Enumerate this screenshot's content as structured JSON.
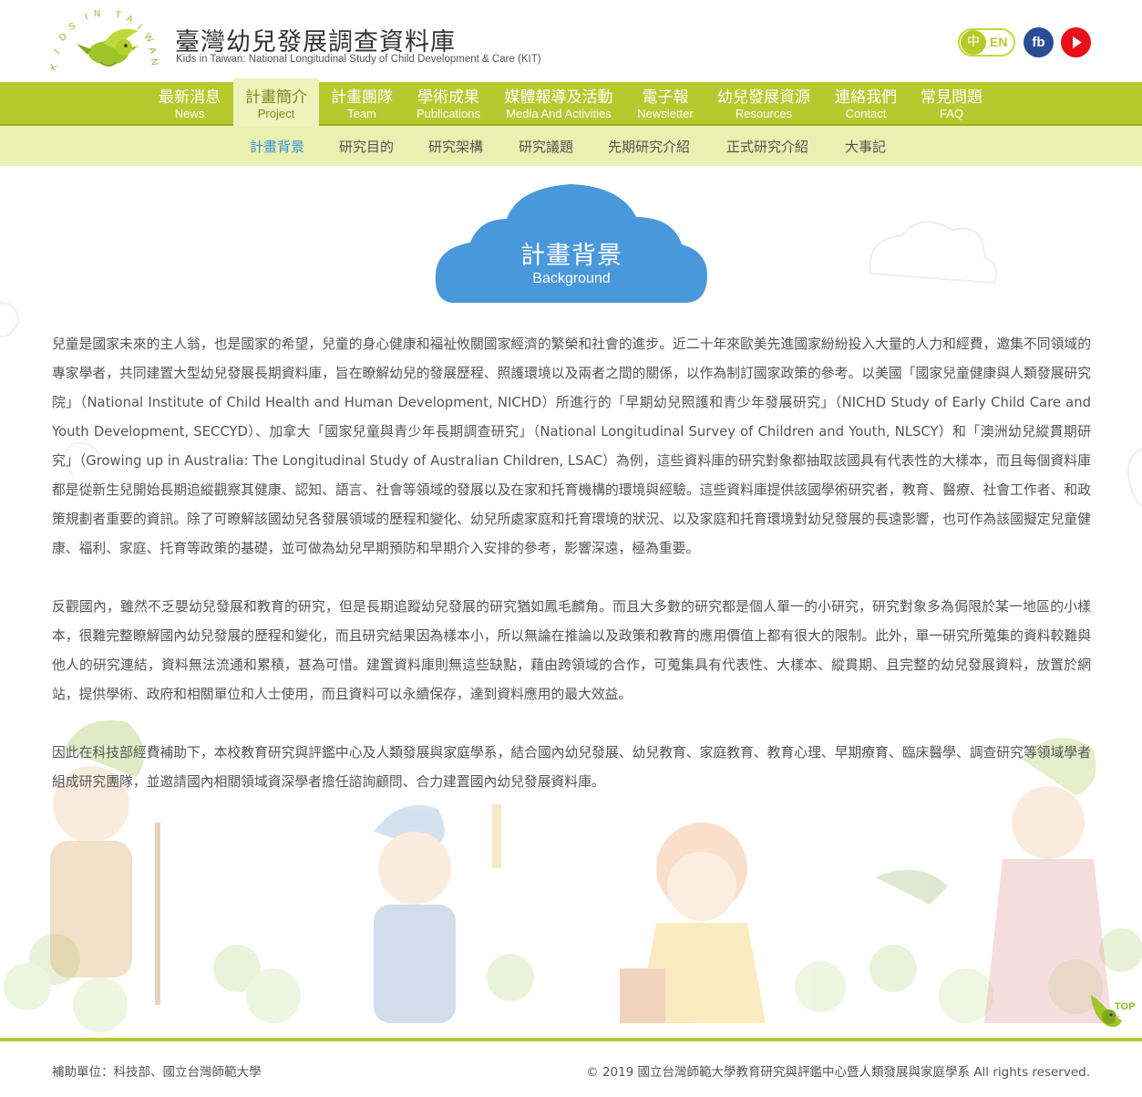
{
  "header": {
    "title": "臺灣幼兒發展調查資料庫",
    "subtitle": "Kids in Taiwan: National Longitudinal Study of Child Development & Care (KIT)",
    "logo_text": "KIDS IN TAIWAN",
    "lang_zh": "中",
    "lang_en": "EN",
    "fb_label": "fb"
  },
  "main_nav": [
    {
      "zh": "最新消息",
      "en": "News"
    },
    {
      "zh": "計畫簡介",
      "en": "Project"
    },
    {
      "zh": "計畫團隊",
      "en": "Team"
    },
    {
      "zh": "學術成果",
      "en": "Publications"
    },
    {
      "zh": "媒體報導及活動",
      "en": "Media And Activities"
    },
    {
      "zh": "電子報",
      "en": "Newsletter"
    },
    {
      "zh": "幼兒發展資源",
      "en": "Resources"
    },
    {
      "zh": "連絡我們",
      "en": "Contact"
    },
    {
      "zh": "常見問題",
      "en": "FAQ"
    }
  ],
  "sub_nav": [
    "計畫背景",
    "研究目的",
    "研究架構",
    "研究議題",
    "先期研究介紹",
    "正式研究介紹",
    "大事記"
  ],
  "page": {
    "title": "計畫背景",
    "subtitle": "Background"
  },
  "article": {
    "p1": "兒童是國家未來的主人翁，也是國家的希望，兒童的身心健康和福祉攸關國家經濟的繁榮和社會的進步。近二十年來歐美先進國家紛紛投入大量的人力和經費，邀集不同領域的專家學者，共同建置大型幼兒發展長期資料庫，旨在瞭解幼兒的發展歷程、照護環境以及兩者之間的關係，以作為制訂國家政策的參考。以美國「國家兒童健康與人類發展研究院」（National Institute of Child Health and Human Development, NICHD）所進行的「早期幼兒照護和青少年發展研究」（NICHD Study of Early Child Care and Youth Development, SECCYD）、加拿大「國家兒童與青少年長期調查研究」（National Longitudinal Survey of Children and Youth, NLSCY）和「澳洲幼兒縱貫期研究」（Growing up in Australia: The Longitudinal Study of Australian Children, LSAC）為例，這些資料庫的研究對象都抽取該國具有代表性的大樣本，而且每個資料庫都是從新生兒開始長期追縱觀察其健康、認知、語言、社會等領域的發展以及在家和托育機構的環境與經驗。這些資料庫提供該國學術研究者，教育、醫療、社會工作者、和政策規劃者重要的資訊。除了可瞭解該國幼兒各發展領域的歷程和變化、幼兒所處家庭和托育環境的狀況、以及家庭和托育環境對幼兒發展的長遠影響，也可作為該國擬定兒童健康、福利、家庭、托育等政策的基礎，並可做為幼兒早期預防和早期介入安排的參考，影響深遠，極為重要。",
    "p2": "反觀國內，雖然不乏嬰幼兒發展和教育的研究，但是長期追蹤幼兒發展的研究猶如鳳毛麟角。而且大多數的研究都是個人單一的小研究，研究對象多為侷限於某一地區的小樣本，很難完整瞭解國內幼兒發展的歷程和變化，而且研究結果因為樣本小，所以無論在推論以及政策和教育的應用價值上都有很大的限制。此外，單一研究所蒐集的資料較難與他人的研究連結，資料無法流通和累積，甚為可惜。建置資料庫則無這些缺點，藉由跨領域的合作，可蒐集具有代表性、大樣本、縱貫期、且完整的幼兒發展資料，放置於網站，提供學術、政府和相關單位和人士使用，而且資料可以永續保存，達到資料應用的最大效益。",
    "p3": "因此在科技部經費補助下，本校教育研究與評鑑中心及人類發展與家庭學系，結合國內幼兒發展、幼兒教育、家庭教育、教育心理、早期療育、臨床醫學、調查研究等領域學者組成研究團隊，並邀請國內相關領域資深學者擔任諮詢顧問、合力建置國內幼兒發展資料庫。"
  },
  "top_button": "TOP",
  "footer": {
    "sponsor": "補助單位：科技部、國立台灣師範大學",
    "copyright": "© 2019 國立台灣師範大學教育研究與評鑑中心暨人類發展與家庭學系 All rights reserved."
  },
  "colors": {
    "nav_green": "#b8c92f",
    "subnav_green": "#e9f0b0",
    "cloud_blue": "#4a98dc",
    "active_link": "#3b8fd6",
    "youtube_red": "#e8101b",
    "facebook_blue": "#2b4d95"
  }
}
